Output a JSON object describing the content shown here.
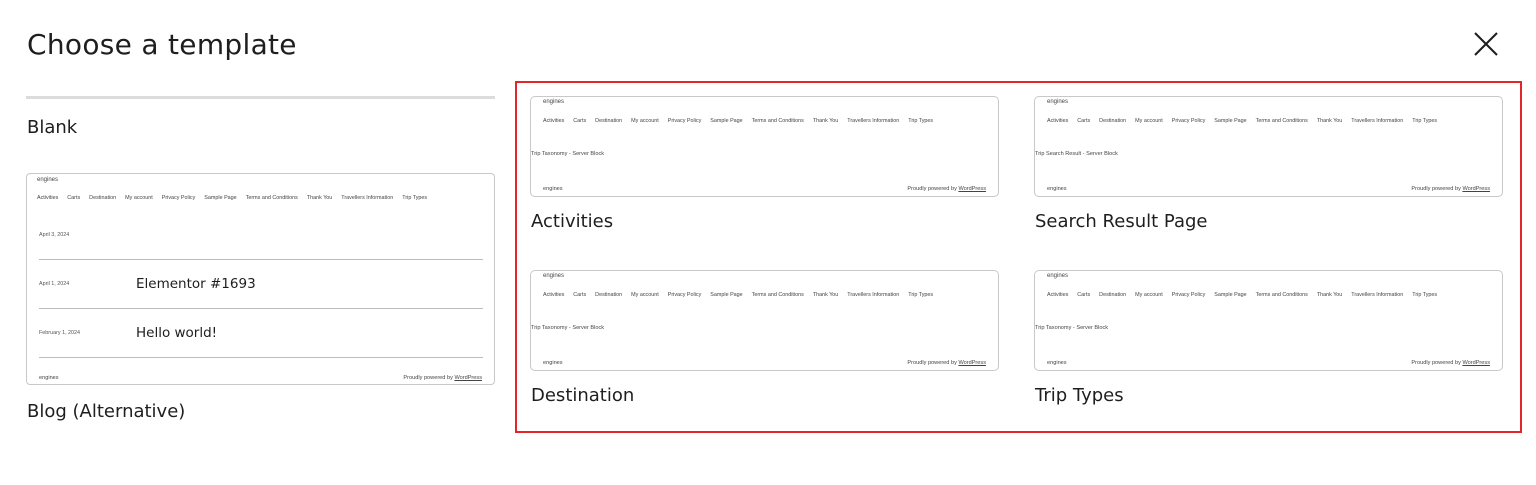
{
  "modal": {
    "title": "Choose a template",
    "close_icon": "close-icon"
  },
  "blank": {
    "label": "Blank"
  },
  "preview_common": {
    "site_title": "engines",
    "nav": [
      "Activities",
      "Carts",
      "Destination",
      "My account",
      "Privacy Policy",
      "Sample Page",
      "Terms and Conditions",
      "Thank You",
      "Travellers Information",
      "Trip Types"
    ],
    "footer_left": "engines",
    "footer_powered": "Proudly powered by",
    "footer_link": "WordPress"
  },
  "blog": {
    "label": "Blog (Alternative)",
    "first_date": "April 3, 2024",
    "posts": [
      {
        "date": "April 1, 2024",
        "title": "Elementor #1693"
      },
      {
        "date": "February 1, 2024",
        "title": "Hello world!"
      }
    ]
  },
  "templates": [
    {
      "label": "Activities",
      "body": "Trip Taxonomy - Server Block"
    },
    {
      "label": "Search Result Page",
      "body": "Trip Search Result - Server Block"
    },
    {
      "label": "Destination",
      "body": "Trip Taxonomy - Server Block"
    },
    {
      "label": "Trip Types",
      "body": "Trip Taxonomy - Server Block"
    }
  ],
  "colors": {
    "selection_border": "#e3262b",
    "card_border": "#c8c8c8"
  }
}
